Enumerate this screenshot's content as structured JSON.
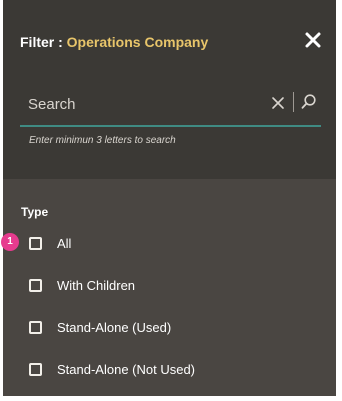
{
  "filter": {
    "title_prefix": "Filter : ",
    "company": "Operations Company",
    "close_icon": "close-icon"
  },
  "search": {
    "placeholder": "Search",
    "value": "",
    "hint": "Enter minimun 3 letters to search",
    "clear_icon": "clear-icon",
    "search_icon": "search-icon"
  },
  "type_section": {
    "heading": "Type",
    "options": [
      {
        "label": "All",
        "checked": false
      },
      {
        "label": "With Children",
        "checked": false
      },
      {
        "label": "Stand-Alone (Used)",
        "checked": false
      },
      {
        "label": "Stand-Alone (Not Used)",
        "checked": false
      }
    ]
  },
  "callout": {
    "number": "1",
    "color": "#e63b8e"
  },
  "colors": {
    "accent": "#e8c56a",
    "underline": "#3f8b83"
  }
}
